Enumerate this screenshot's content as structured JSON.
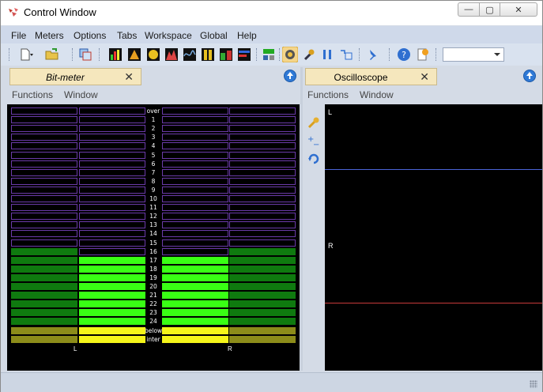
{
  "window": {
    "title": "Control Window"
  },
  "menu": [
    "File",
    "Meters",
    "Options",
    "Tabs",
    "Workspace",
    "Global",
    "Help"
  ],
  "toolbar": {
    "icons": [
      "new-document-icon",
      "open-folder-icon",
      "copy-windows-icon",
      "meter-icon-1",
      "meter-icon-2",
      "meter-icon-3",
      "meter-icon-4",
      "meter-icon-5",
      "meter-icon-6",
      "meter-icon-7",
      "meter-icon-8",
      "layout-icon",
      "target-icon",
      "wrench-icon",
      "pause-icon",
      "input-icon",
      "pin-icon",
      "help-icon",
      "info-icon"
    ],
    "combo_value": ""
  },
  "bitmeter": {
    "tab_label": "Bit-meter",
    "close_glyph": "✕",
    "submenu": [
      "Functions",
      "Window"
    ],
    "rows": [
      "over",
      "1",
      "2",
      "3",
      "4",
      "5",
      "6",
      "7",
      "8",
      "9",
      "10",
      "11",
      "12",
      "13",
      "14",
      "15",
      "16",
      "17",
      "18",
      "19",
      "20",
      "21",
      "22",
      "23",
      "24",
      "below",
      "inter"
    ],
    "channel_left": "L",
    "channel_right": "R",
    "colors": {
      "empty_border": "#6a3aa8",
      "green_dark": "#0f7a0f",
      "green_bright": "#39ff14",
      "olive": "#8c8c1a",
      "yellow": "#f5f51a"
    }
  },
  "oscilloscope": {
    "tab_label": "Oscilloscope",
    "close_glyph": "✕",
    "submenu": [
      "Functions",
      "Window"
    ],
    "channel_left": "L",
    "channel_right": "R",
    "tools": [
      "wrench-icon",
      "zoom-icon",
      "rotate-icon"
    ],
    "colors": {
      "left_trace": "#4a63d6",
      "right_trace": "#c83a3a"
    }
  },
  "titlebar_buttons": {
    "minimize": "—",
    "maximize": "▢",
    "close": "✕"
  }
}
